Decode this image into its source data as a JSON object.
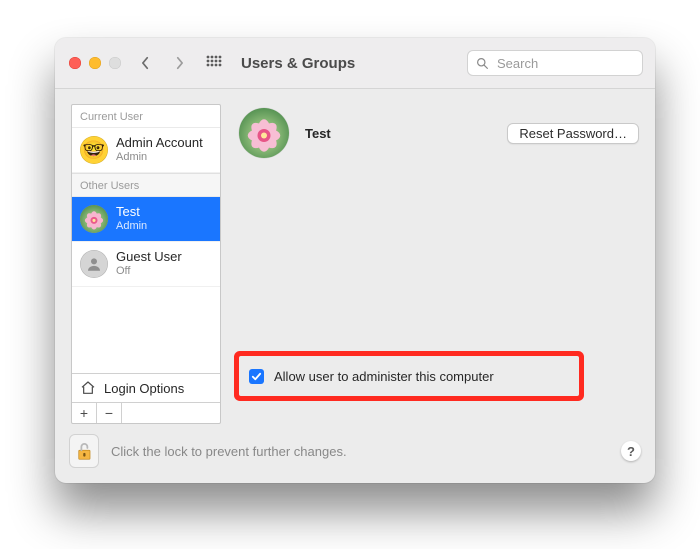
{
  "window": {
    "title": "Users & Groups"
  },
  "search": {
    "placeholder": "Search",
    "value": ""
  },
  "sidebar": {
    "section_current": "Current User",
    "section_other": "Other Users",
    "current_user": {
      "name": "Admin Account",
      "role": "Admin",
      "avatar_icon": "emoji-glasses-face"
    },
    "other_users": [
      {
        "name": "Test",
        "role": "Admin",
        "avatar_icon": "flower",
        "selected": true
      },
      {
        "name": "Guest User",
        "role": "Off",
        "avatar_icon": "guest",
        "selected": false
      }
    ],
    "login_options": "Login Options",
    "add_label": "+",
    "remove_label": "−"
  },
  "main": {
    "user_name": "Test",
    "reset_password": "Reset Password…",
    "allow_admin_label": "Allow user to administer this computer",
    "allow_admin_checked": true
  },
  "footer": {
    "lock_hint": "Click the lock to prevent further changes.",
    "help_label": "?"
  }
}
